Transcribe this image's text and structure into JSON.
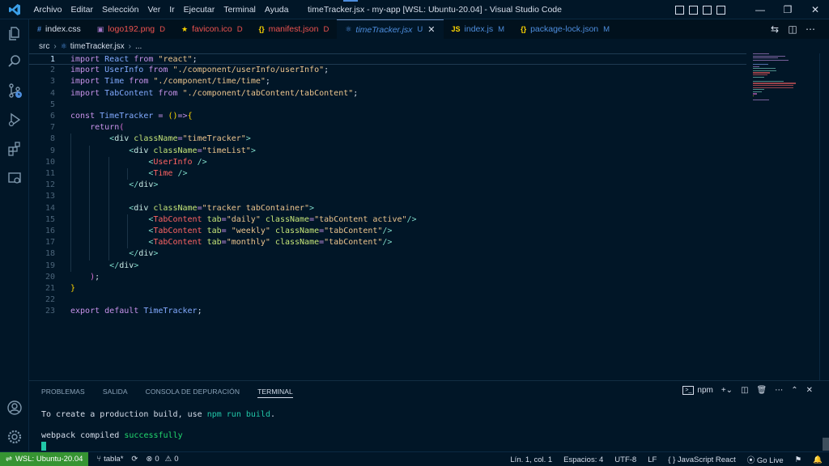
{
  "titlebar": {
    "menu": [
      "Archivo",
      "Editar",
      "Selección",
      "Ver",
      "Ir",
      "Ejecutar",
      "Terminal",
      "Ayuda"
    ],
    "title": "timeTracker.jsx - my-app [WSL: Ubuntu-20.04] - Visual Studio Code",
    "controls": {
      "minimize": "—",
      "restore": "❐",
      "close": "✕"
    }
  },
  "tabs": [
    {
      "icon": "#",
      "icon_color": "#4d8ddd",
      "label": "index.css",
      "badge": "",
      "badge_color": "#d6deeb",
      "label_color": "#d6deeb"
    },
    {
      "icon": "▣",
      "icon_color": "#a074c4",
      "label": "logo192.png",
      "badge": "D",
      "badge_color": "#ef5350",
      "label_color": "#ef5350"
    },
    {
      "icon": "★",
      "icon_color": "#ffd700",
      "label": "favicon.ico",
      "badge": "D",
      "badge_color": "#ef5350",
      "label_color": "#ef5350"
    },
    {
      "icon": "{}",
      "icon_color": "#ffd700",
      "label": "manifest.json",
      "badge": "D",
      "badge_color": "#ef5350",
      "label_color": "#ef5350"
    },
    {
      "icon": "⚛",
      "icon_color": "#4d8ddd",
      "label": "timeTracker.jsx",
      "badge": "U",
      "badge_color": "#4d8ddd",
      "label_color": "#4d8ddd",
      "active": true,
      "close": "✕"
    },
    {
      "icon": "JS",
      "icon_color": "#ffd700",
      "label": "index.js",
      "badge": "M",
      "badge_color": "#4d8ddd",
      "label_color": "#4d8ddd"
    },
    {
      "icon": "{}",
      "icon_color": "#ffd700",
      "label": "package-lock.json",
      "badge": "M",
      "badge_color": "#4d8ddd",
      "label_color": "#4d8ddd"
    }
  ],
  "breadcrumb": {
    "folder": "src",
    "sep1": "›",
    "icon": "⚛",
    "file": "timeTracker.jsx",
    "sep2": "›",
    "rest": "..."
  },
  "editor": {
    "current_line": 1,
    "lines": [
      [
        [
          "k",
          "import"
        ],
        [
          "p",
          " "
        ],
        [
          "v",
          "React"
        ],
        [
          "p",
          " "
        ],
        [
          "k",
          "from"
        ],
        [
          "p",
          " "
        ],
        [
          "s",
          "\"react\""
        ],
        [
          "p",
          ";"
        ]
      ],
      [
        [
          "k",
          "import"
        ],
        [
          "p",
          " "
        ],
        [
          "v",
          "UserInfo"
        ],
        [
          "p",
          " "
        ],
        [
          "k",
          "from"
        ],
        [
          "p",
          " "
        ],
        [
          "s",
          "\"./component/userInfo/userInfo\""
        ],
        [
          "p",
          ";"
        ]
      ],
      [
        [
          "k",
          "import"
        ],
        [
          "p",
          " "
        ],
        [
          "v",
          "Time"
        ],
        [
          "p",
          " "
        ],
        [
          "k",
          "from"
        ],
        [
          "p",
          " "
        ],
        [
          "s",
          "\"./component/time/time\""
        ],
        [
          "p",
          ";"
        ]
      ],
      [
        [
          "k",
          "import"
        ],
        [
          "p",
          " "
        ],
        [
          "v",
          "TabContent"
        ],
        [
          "p",
          " "
        ],
        [
          "k",
          "from"
        ],
        [
          "p",
          " "
        ],
        [
          "s",
          "\"./component/tabContent/tabContent\""
        ],
        [
          "p",
          ";"
        ]
      ],
      [],
      [
        [
          "k",
          "const"
        ],
        [
          "p",
          " "
        ],
        [
          "v",
          "TimeTracker"
        ],
        [
          "p",
          " "
        ],
        [
          "k",
          "="
        ],
        [
          "p",
          " "
        ],
        [
          "y",
          "()"
        ],
        [
          "k",
          "=>"
        ],
        [
          "y",
          "{"
        ]
      ],
      [
        [
          "p",
          "    "
        ],
        [
          "k",
          "return"
        ],
        [
          "pk",
          "("
        ]
      ],
      [
        [
          "p",
          "        "
        ],
        [
          "pu",
          "<"
        ],
        [
          "t",
          "div"
        ],
        [
          "p",
          " "
        ],
        [
          "a",
          "className"
        ],
        [
          "k",
          "="
        ],
        [
          "s",
          "\"timeTracker\""
        ],
        [
          "pu",
          ">"
        ]
      ],
      [
        [
          "p",
          "            "
        ],
        [
          "pu",
          "<"
        ],
        [
          "t",
          "div"
        ],
        [
          "p",
          " "
        ],
        [
          "a",
          "className"
        ],
        [
          "k",
          "="
        ],
        [
          "s",
          "\"timeList\""
        ],
        [
          "pu",
          ">"
        ]
      ],
      [
        [
          "p",
          "                "
        ],
        [
          "pu",
          "<"
        ],
        [
          "tag",
          "UserInfo"
        ],
        [
          "p",
          " "
        ],
        [
          "pu",
          "/>"
        ]
      ],
      [
        [
          "p",
          "                "
        ],
        [
          "pu",
          "<"
        ],
        [
          "tag",
          "Time"
        ],
        [
          "p",
          " "
        ],
        [
          "pu",
          "/>"
        ]
      ],
      [
        [
          "p",
          "            "
        ],
        [
          "pu",
          "</"
        ],
        [
          "t",
          "div"
        ],
        [
          "pu",
          ">"
        ]
      ],
      [],
      [
        [
          "p",
          "            "
        ],
        [
          "pu",
          "<"
        ],
        [
          "t",
          "div"
        ],
        [
          "p",
          " "
        ],
        [
          "a",
          "className"
        ],
        [
          "k",
          "="
        ],
        [
          "s",
          "\"tracker tabContainer\""
        ],
        [
          "pu",
          ">"
        ]
      ],
      [
        [
          "p",
          "                "
        ],
        [
          "pu",
          "<"
        ],
        [
          "tag",
          "TabContent"
        ],
        [
          "p",
          " "
        ],
        [
          "a",
          "tab"
        ],
        [
          "k",
          "="
        ],
        [
          "s",
          "\"daily\""
        ],
        [
          "p",
          " "
        ],
        [
          "a",
          "className"
        ],
        [
          "k",
          "="
        ],
        [
          "s",
          "\"tabContent active\""
        ],
        [
          "pu",
          "/>"
        ]
      ],
      [
        [
          "p",
          "                "
        ],
        [
          "pu",
          "<"
        ],
        [
          "tag",
          "TabContent"
        ],
        [
          "p",
          " "
        ],
        [
          "a",
          "tab"
        ],
        [
          "k",
          "="
        ],
        [
          "p",
          " "
        ],
        [
          "s",
          "\"weekly\""
        ],
        [
          "p",
          " "
        ],
        [
          "a",
          "className"
        ],
        [
          "k",
          "="
        ],
        [
          "s",
          "\"tabContent\""
        ],
        [
          "pu",
          "/>"
        ]
      ],
      [
        [
          "p",
          "                "
        ],
        [
          "pu",
          "<"
        ],
        [
          "tag",
          "TabContent"
        ],
        [
          "p",
          " "
        ],
        [
          "a",
          "tab"
        ],
        [
          "k",
          "="
        ],
        [
          "s",
          "\"monthly\""
        ],
        [
          "p",
          " "
        ],
        [
          "a",
          "className"
        ],
        [
          "k",
          "="
        ],
        [
          "s",
          "\"tabContent\""
        ],
        [
          "pu",
          "/>"
        ]
      ],
      [
        [
          "p",
          "            "
        ],
        [
          "pu",
          "</"
        ],
        [
          "t",
          "div"
        ],
        [
          "pu",
          ">"
        ]
      ],
      [
        [
          "p",
          "        "
        ],
        [
          "pu",
          "</"
        ],
        [
          "t",
          "div"
        ],
        [
          "pu",
          ">"
        ]
      ],
      [
        [
          "p",
          "    "
        ],
        [
          "pk",
          ")"
        ],
        [
          "p",
          ";"
        ]
      ],
      [
        [
          "y",
          "}"
        ]
      ],
      [],
      [
        [
          "k",
          "export"
        ],
        [
          "p",
          " "
        ],
        [
          "k",
          "default"
        ],
        [
          "p",
          " "
        ],
        [
          "v",
          "TimeTracker"
        ],
        [
          "p",
          ";"
        ]
      ]
    ]
  },
  "panel": {
    "tabs": [
      {
        "label": "PROBLEMAS"
      },
      {
        "label": "SALIDA"
      },
      {
        "label": "CONSOLA DE DEPURACIÓN"
      },
      {
        "label": "TERMINAL",
        "active": true
      }
    ],
    "terminal_name": "npm",
    "terminal_lines": [
      [
        [
          "w",
          "To create a production build, use "
        ],
        [
          "cyan",
          "npm run build"
        ],
        [
          "w",
          "."
        ]
      ],
      [],
      [
        [
          "w",
          "webpack compiled "
        ],
        [
          "green",
          "successfully"
        ]
      ]
    ]
  },
  "statusbar": {
    "remote": "WSL: Ubuntu-20.04",
    "branch": "tabla*",
    "errors": "0",
    "warnings": "0",
    "position": "Lín. 1, col. 1",
    "spaces": "Espacios: 4",
    "encoding": "UTF-8",
    "eol": "LF",
    "language": "JavaScript React",
    "golive": "Go Live"
  },
  "colors": {
    "background": "#011627",
    "remote_badge": "#369432",
    "accent": "#4d8ddd",
    "deleted": "#ef5350"
  }
}
